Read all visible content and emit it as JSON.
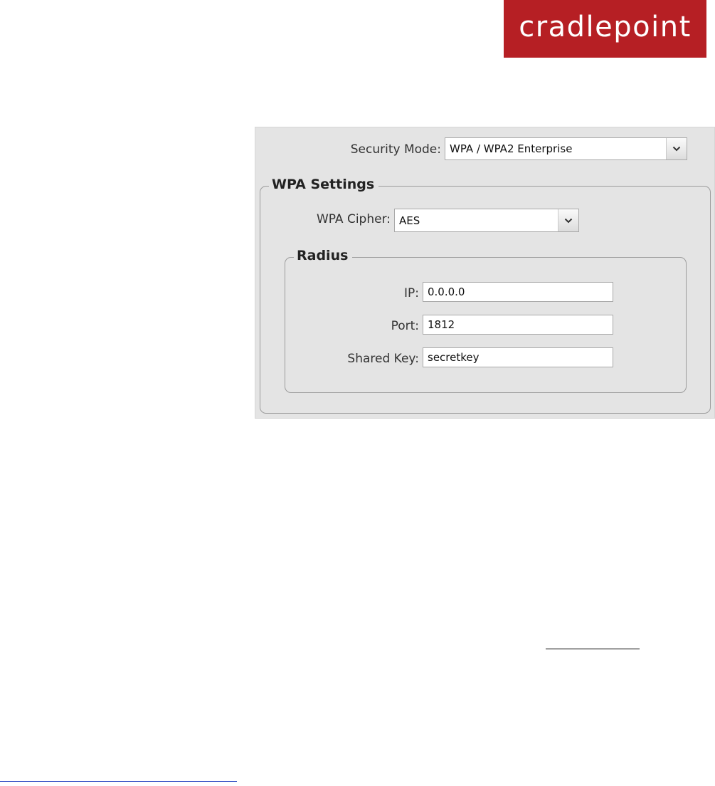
{
  "logo": {
    "text": "cradlepoint",
    "color": "#b61f24"
  },
  "security_mode": {
    "label": "Security Mode:",
    "value": "WPA / WPA2 Enterprise"
  },
  "wpa_settings": {
    "legend": "WPA Settings",
    "cipher_label": "WPA Cipher:",
    "cipher_value": "AES",
    "radius": {
      "legend": "Radius",
      "ip_label": "IP:",
      "ip_value": "0.0.0.0",
      "port_label": "Port:",
      "port_value": "1812",
      "shared_key_label": "Shared Key:",
      "shared_key_value": "secretkey"
    }
  },
  "icons": {
    "dropdown": "chevron-down-icon"
  }
}
